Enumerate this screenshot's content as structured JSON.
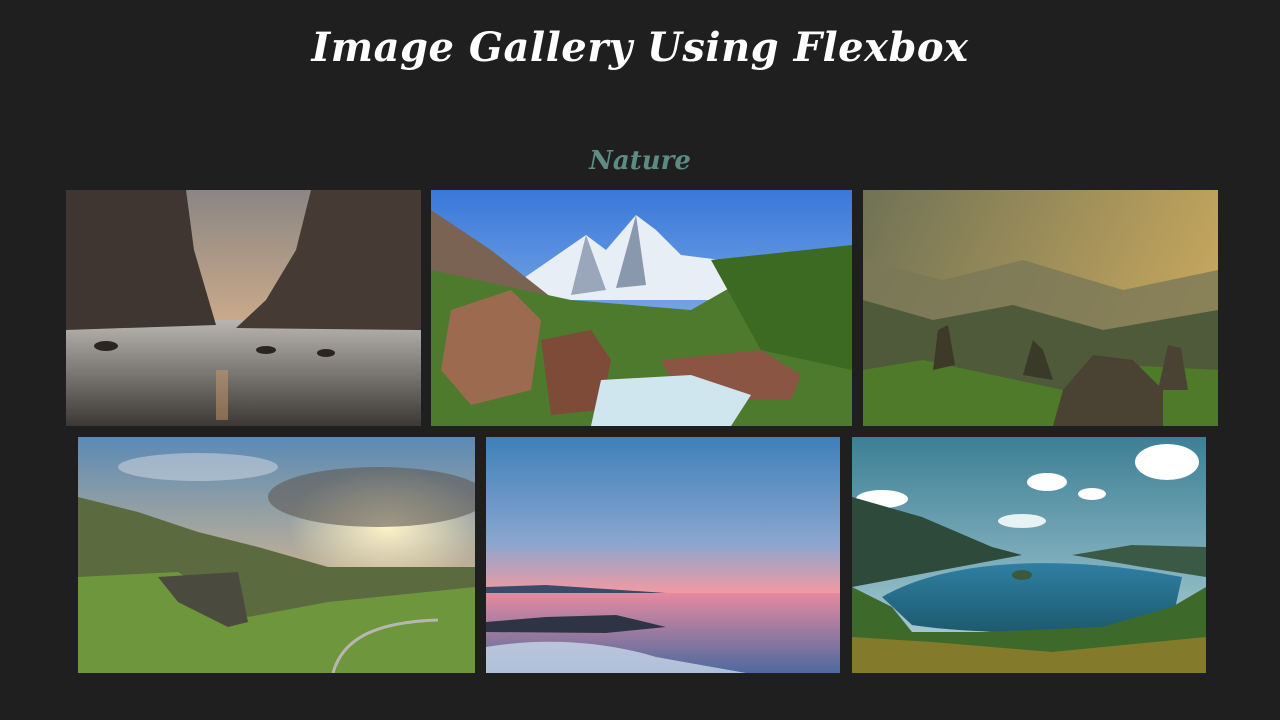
{
  "header": {
    "title": "Image Gallery Using Flexbox"
  },
  "gallery": {
    "section_title": "Nature",
    "images": [
      {
        "icon": "sea-arch-beach-image"
      },
      {
        "icon": "mountain-stream-image"
      },
      {
        "icon": "misty-valley-image"
      },
      {
        "icon": "green-cliffs-sunset-image"
      },
      {
        "icon": "ocean-sunset-image"
      },
      {
        "icon": "mountain-lake-image"
      }
    ]
  },
  "colors": {
    "background": "#1f1f1f",
    "title": "#ffffff",
    "section_title_start": "#6e9bb0",
    "section_title_end": "#4f7a5a"
  }
}
